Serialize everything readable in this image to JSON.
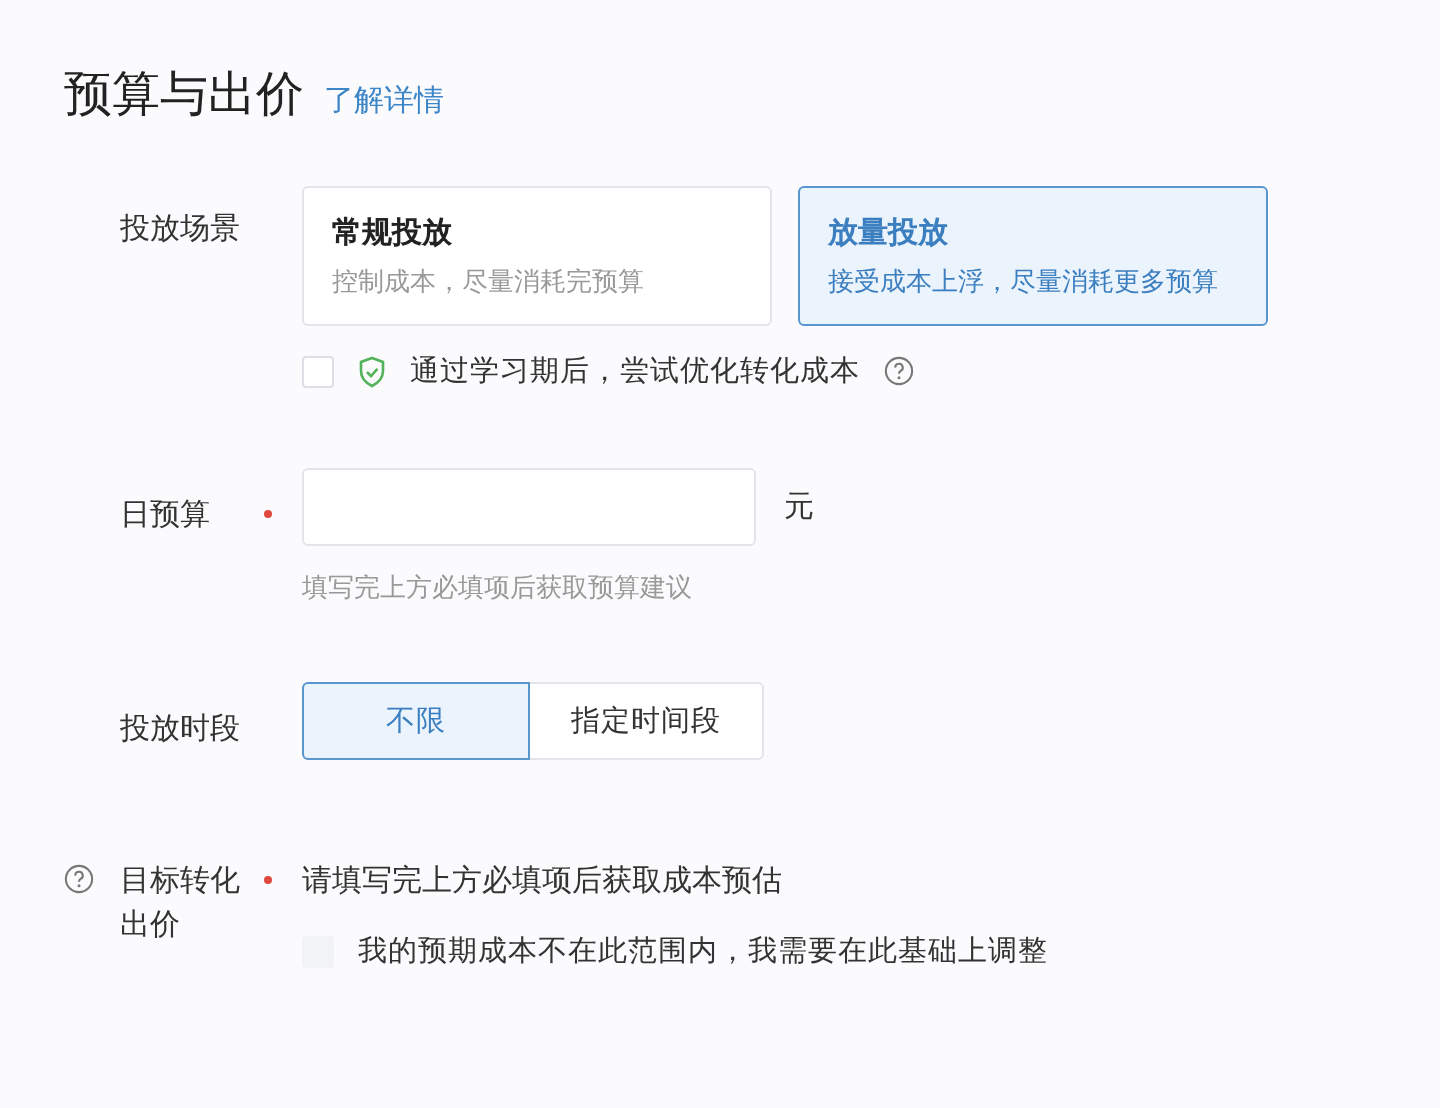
{
  "title": "预算与出价",
  "link": "了解详情",
  "scene": {
    "label": "投放场景",
    "options": [
      {
        "title": "常规投放",
        "desc": "控制成本，尽量消耗完预算",
        "selected": false
      },
      {
        "title": "放量投放",
        "desc": "接受成本上浮，尽量消耗更多预算",
        "selected": true
      }
    ],
    "optimize": {
      "checked": false,
      "text": "通过学习期后，尝试优化转化成本"
    }
  },
  "budget": {
    "label": "日预算",
    "required": true,
    "unit": "元",
    "hint": "填写完上方必填项后获取预算建议"
  },
  "schedule": {
    "label": "投放时段",
    "options": [
      {
        "label": "不限",
        "selected": true
      },
      {
        "label": "指定时间段",
        "selected": false
      }
    ]
  },
  "bid": {
    "label": "目标转化出价",
    "required": true,
    "message": "请填写完上方必填项后获取成本预估",
    "adjust": {
      "checked": false,
      "disabled": true,
      "text": "我的预期成本不在此范围内，我需要在此基础上调整"
    }
  }
}
